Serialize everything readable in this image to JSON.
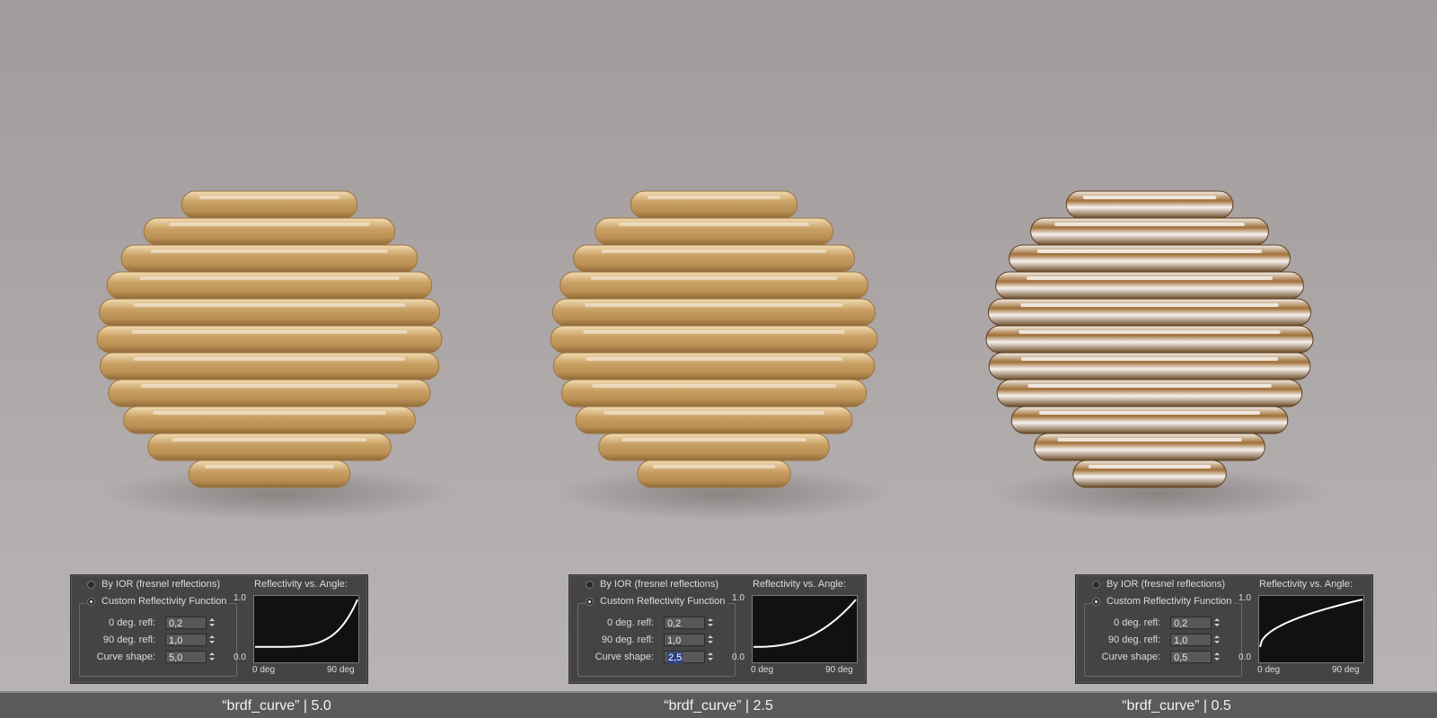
{
  "colors": {
    "background": "#a9a3a4",
    "panel_bg": "#444444",
    "graph_bg": "#111111",
    "caption_bar": "#5a5a5a",
    "material": "#c9a468",
    "selection": "#2b3f86"
  },
  "panels": [
    {
      "radio_ior_label": "By IOR (fresnel reflections)",
      "radio_custom_label": "Custom Reflectivity Function",
      "selected": "custom",
      "refl0_label": "0 deg. refl:",
      "refl0_value": "0,2",
      "refl90_label": "90 deg. refl:",
      "refl90_value": "1,0",
      "curve_label": "Curve shape:",
      "curve_value": "5,0",
      "curve_selected": false,
      "graph_title": "Reflectivity vs. Angle:",
      "y_max_label": "1.0",
      "y_min_label": "0.0",
      "x_min_label": "0 deg",
      "x_max_label": "90 deg",
      "caption": "“brdf_curve” | 5.0"
    },
    {
      "radio_ior_label": "By IOR (fresnel reflections)",
      "radio_custom_label": "Custom Reflectivity Function",
      "selected": "custom",
      "refl0_label": "0 deg. refl:",
      "refl0_value": "0,2",
      "refl90_label": "90 deg. refl:",
      "refl90_value": "1,0",
      "curve_label": "Curve shape:",
      "curve_value": "2,5",
      "curve_selected": true,
      "graph_title": "Reflectivity vs. Angle:",
      "y_max_label": "1.0",
      "y_min_label": "0.0",
      "x_min_label": "0 deg",
      "x_max_label": "90 deg",
      "caption": "“brdf_curve” | 2.5"
    },
    {
      "radio_ior_label": "By IOR (fresnel reflections)",
      "radio_custom_label": "Custom Reflectivity Function",
      "selected": "custom",
      "refl0_label": "0 deg. refl:",
      "refl0_value": "0,2",
      "refl90_label": "90 deg. refl:",
      "refl90_value": "1,0",
      "curve_label": "Curve shape:",
      "curve_value": "0,5",
      "curve_selected": false,
      "graph_title": "Reflectivity vs. Angle:",
      "y_max_label": "1.0",
      "y_min_label": "0.0",
      "x_min_label": "0 deg",
      "x_max_label": "90 deg",
      "caption": "“brdf_curve” | 0.5"
    }
  ],
  "curves": [
    {
      "refl0": 0.2,
      "refl90": 1.0,
      "shape": 5.0
    },
    {
      "refl0": 0.2,
      "refl90": 1.0,
      "shape": 2.5
    },
    {
      "refl0": 0.2,
      "refl90": 1.0,
      "shape": 0.5
    }
  ]
}
